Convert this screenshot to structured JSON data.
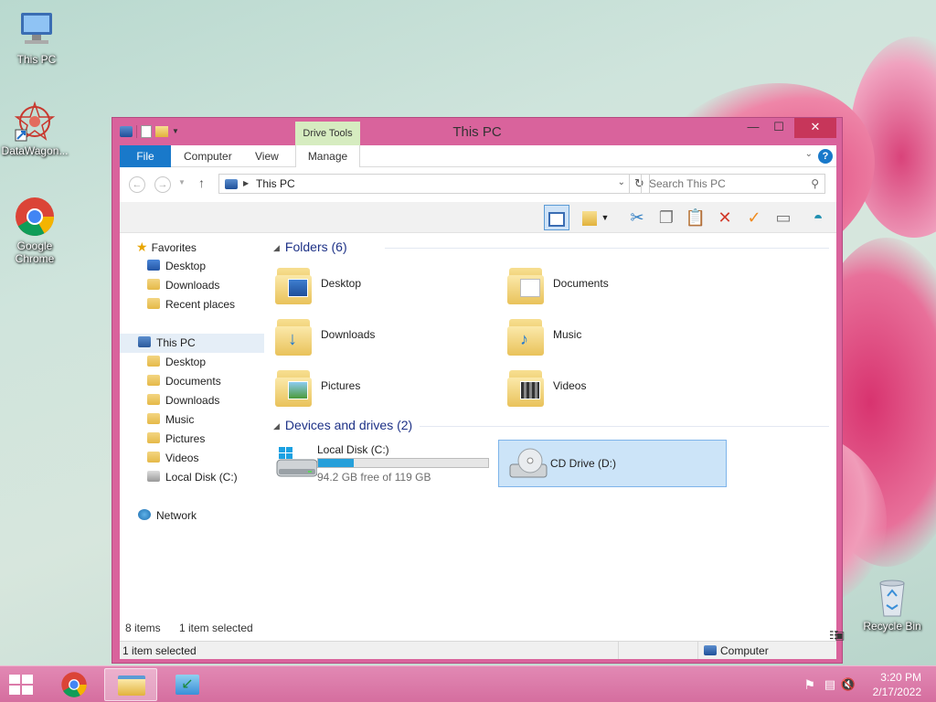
{
  "desktop": {
    "icons": [
      {
        "label": "This PC"
      },
      {
        "label": "DataWagon..."
      },
      {
        "label": "Google Chrome"
      },
      {
        "label": "Recycle Bin"
      }
    ]
  },
  "window": {
    "title": "This PC",
    "drive_tools_label": "Drive Tools",
    "close_symbol": "✕",
    "max_symbol": "☐",
    "min_symbol": "—"
  },
  "ribbon": {
    "tabs": {
      "file": "File",
      "computer": "Computer",
      "view": "View",
      "manage": "Manage"
    },
    "help_symbol": "?"
  },
  "address": {
    "path": "This PC",
    "search_placeholder": "Search This PC"
  },
  "nav": {
    "favorites": "Favorites",
    "fav_items": [
      "Desktop",
      "Downloads",
      "Recent places"
    ],
    "this_pc": "This PC",
    "pc_items": [
      "Desktop",
      "Documents",
      "Downloads",
      "Music",
      "Pictures",
      "Videos",
      "Local Disk (C:)"
    ],
    "network": "Network"
  },
  "folders": {
    "header": "Folders (6)",
    "items": [
      "Desktop",
      "Documents",
      "Downloads",
      "Music",
      "Pictures",
      "Videos"
    ]
  },
  "drives": {
    "header": "Devices and drives (2)",
    "items": [
      {
        "name": "Local Disk (C:)",
        "free": "94.2 GB free of 119 GB",
        "used_fraction": 0.21
      },
      {
        "name": "CD Drive (D:)"
      }
    ]
  },
  "status": {
    "items_count": "8 items",
    "selected": "1 item selected",
    "bottom_left": "1 item selected",
    "bottom_right": "Computer"
  },
  "taskbar": {
    "time": "3:20 PM",
    "date": "2/17/2022"
  },
  "colors": {
    "accent": "#1979ca",
    "window_frame": "#d9639c",
    "selection": "#cce4f8",
    "drive_bar": "#26a0da"
  }
}
